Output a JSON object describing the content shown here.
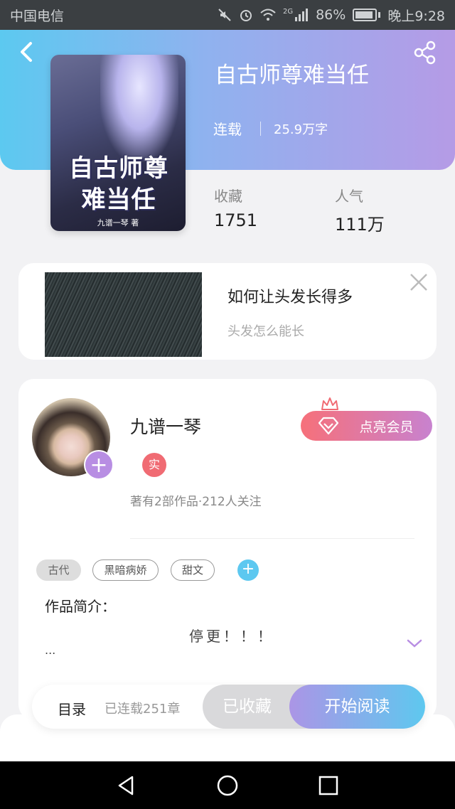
{
  "status_bar": {
    "carrier": "中国电信",
    "network": "2G",
    "battery": "86%",
    "time": "晚上9:28"
  },
  "book": {
    "title": "自古师尊难当任",
    "status": "连载",
    "word_count": "25.9万字",
    "cover_title_line1": "自古师尊",
    "cover_title_line2": "难当任",
    "cover_author": "九谱一琴 著",
    "collect_label": "收藏",
    "collect_value": "1751",
    "popularity_label": "人气",
    "popularity_value": "111万"
  },
  "ad": {
    "title": "如何让头发长得多",
    "subtitle": "头发怎么能长"
  },
  "author": {
    "name": "九谱一琴",
    "badge": "实",
    "meta": "著有2部作品·212人关注",
    "vip_button": "点亮会员"
  },
  "tags": [
    "古代",
    "黑暗病娇",
    "甜文"
  ],
  "intro": {
    "label": "作品简介：",
    "text": "停更！！！",
    "ellipsis": "..."
  },
  "action_bar": {
    "toc": "目录",
    "chapters": "已连载251章",
    "collected": "已收藏",
    "read": "开始阅读"
  },
  "colors": {
    "hero_gradient_start": "#5cc9f0",
    "hero_gradient_end": "#b59be6",
    "vip_start": "#f6707a",
    "read_start": "#ab95e6",
    "read_end": "#5ec8ef",
    "accent_purple": "#b88ee3"
  },
  "icons": [
    "mute-icon",
    "alarm-icon",
    "wifi-icon",
    "signal-icon",
    "battery-icon",
    "back-icon",
    "share-icon",
    "close-icon",
    "plus-icon",
    "crown-icon",
    "diamond-icon",
    "chevron-down-icon",
    "nav-back-icon",
    "nav-home-icon",
    "nav-recents-icon"
  ]
}
